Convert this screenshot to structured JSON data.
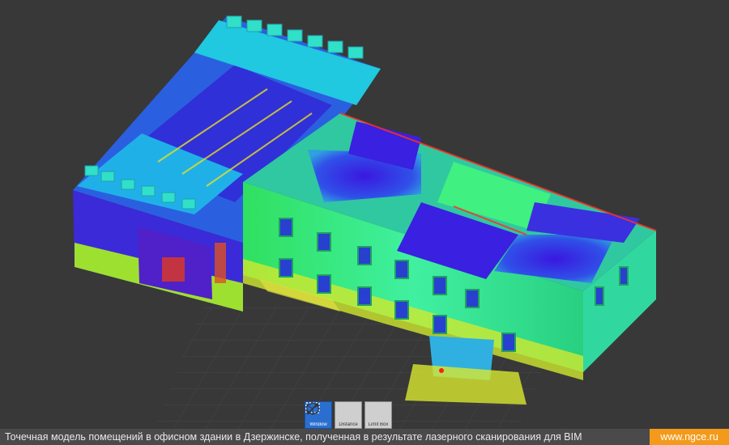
{
  "toolbar": {
    "tools": [
      {
        "label": "Window",
        "icon": "window-select-icon",
        "active": true
      },
      {
        "label": "Distance",
        "icon": "distance-measure-icon",
        "active": false
      },
      {
        "label": "Limit Box",
        "icon": "limit-box-icon",
        "active": false
      }
    ]
  },
  "caption": {
    "text": "Точечная модель помещений в офисном здании в Дзержинске, полученная в результате лазерного сканирования для BIM",
    "link": "www.ngce.ru"
  },
  "colors": {
    "background": "#383838",
    "caption_bar": "#4a4a4a",
    "accent": "#f39a1a",
    "active_tool": "#2a6fd0",
    "scan_low": "#2a10d8",
    "scan_mid": "#20e070",
    "scan_high": "#e8f020",
    "scan_max": "#ff2a10"
  }
}
